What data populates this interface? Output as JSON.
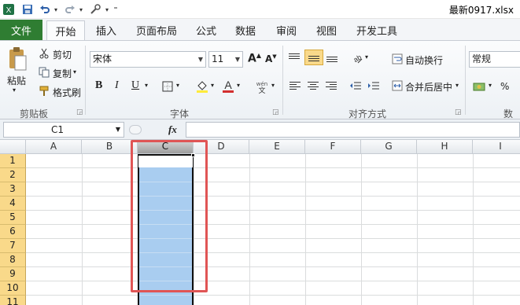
{
  "window": {
    "title": "最新0917.xlsx"
  },
  "quick_access": {
    "save_icon": "save-icon",
    "undo_icon": "undo-icon",
    "redo_icon": "redo-icon",
    "customize_icon": "customize-icon"
  },
  "tabs": [
    "文件",
    "开始",
    "插入",
    "页面布局",
    "公式",
    "数据",
    "审阅",
    "视图",
    "开发工具"
  ],
  "clipboard": {
    "paste": "粘贴",
    "cut": "剪切",
    "copy": "复制",
    "format_painter": "格式刷",
    "group": "剪贴板"
  },
  "font": {
    "name": "宋体",
    "size": "11",
    "bold": "B",
    "italic": "I",
    "underline": "U",
    "group": "字体"
  },
  "alignment": {
    "wrap_text": "自动换行",
    "merge_center": "合并后居中",
    "group": "对齐方式"
  },
  "number": {
    "format": "常规",
    "percent": "%",
    "group": "数字"
  },
  "formula_bar": {
    "name_box": "C1",
    "fx": "fx",
    "value": ""
  },
  "sheet": {
    "columns": [
      "A",
      "B",
      "C",
      "D",
      "E",
      "F",
      "G",
      "H",
      "I"
    ],
    "rows": [
      "1",
      "2",
      "3",
      "4",
      "5",
      "6",
      "7",
      "8",
      "9",
      "10",
      "11"
    ],
    "selected_column": "C",
    "selection_range": "C1:C11"
  },
  "colors": {
    "file_tab": "#2f7d32",
    "selection_fill": "#a9cdf0",
    "highlight_box": "#e05555",
    "row_header": "#f9d98a"
  }
}
